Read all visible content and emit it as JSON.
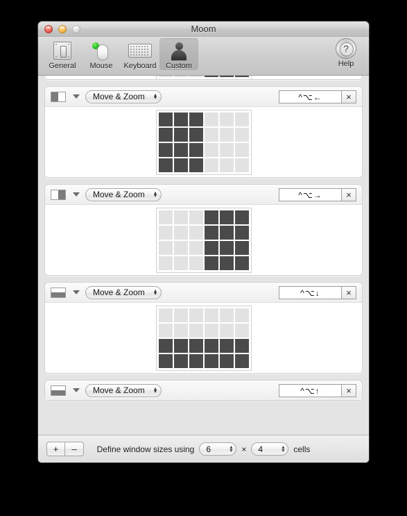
{
  "window": {
    "title": "Moom",
    "traffic_lights": [
      "close",
      "minimize",
      "zoom"
    ]
  },
  "toolbar": {
    "items": [
      {
        "label": "General",
        "icon": "light-switch-icon",
        "selected": false
      },
      {
        "label": "Mouse",
        "icon": "mouse-icon",
        "selected": false
      },
      {
        "label": "Keyboard",
        "icon": "keyboard-icon",
        "selected": false
      },
      {
        "label": "Custom",
        "icon": "person-icon",
        "selected": true
      }
    ],
    "help": {
      "label": "Help",
      "icon": "help-question-icon"
    }
  },
  "grid_size": {
    "cols": 6,
    "rows": 4
  },
  "panels": [
    {
      "clipped": true,
      "thumb": {
        "type": "half-right",
        "orientation": "row"
      },
      "action": "Move & Zoom",
      "hotkey": "",
      "clear_label": "×",
      "grid": {
        "cols": 6,
        "rows": 4,
        "filled": [
          [
            false,
            false,
            false,
            true,
            true,
            true
          ],
          [
            false,
            false,
            false,
            true,
            true,
            true
          ],
          [
            false,
            false,
            false,
            true,
            true,
            true
          ],
          [
            false,
            false,
            false,
            true,
            true,
            true
          ]
        ]
      }
    },
    {
      "clipped": false,
      "thumb": {
        "type": "half-left",
        "orientation": "row"
      },
      "action": "Move & Zoom",
      "hotkey": "^⌥←",
      "clear_label": "×",
      "grid": {
        "cols": 6,
        "rows": 4,
        "filled": [
          [
            true,
            true,
            true,
            false,
            false,
            false
          ],
          [
            true,
            true,
            true,
            false,
            false,
            false
          ],
          [
            true,
            true,
            true,
            false,
            false,
            false
          ],
          [
            true,
            true,
            true,
            false,
            false,
            false
          ]
        ]
      }
    },
    {
      "clipped": false,
      "thumb": {
        "type": "half-right",
        "orientation": "row"
      },
      "action": "Move & Zoom",
      "hotkey": "^⌥→",
      "clear_label": "×",
      "grid": {
        "cols": 6,
        "rows": 4,
        "filled": [
          [
            false,
            false,
            false,
            true,
            true,
            true
          ],
          [
            false,
            false,
            false,
            true,
            true,
            true
          ],
          [
            false,
            false,
            false,
            true,
            true,
            true
          ],
          [
            false,
            false,
            false,
            true,
            true,
            true
          ]
        ]
      }
    },
    {
      "clipped": false,
      "thumb": {
        "type": "half-bottom",
        "orientation": "col"
      },
      "action": "Move & Zoom",
      "hotkey": "^⌥↓",
      "clear_label": "×",
      "grid": {
        "cols": 6,
        "rows": 4,
        "filled": [
          [
            false,
            false,
            false,
            false,
            false,
            false
          ],
          [
            false,
            false,
            false,
            false,
            false,
            false
          ],
          [
            true,
            true,
            true,
            true,
            true,
            true
          ],
          [
            true,
            true,
            true,
            true,
            true,
            true
          ]
        ]
      }
    },
    {
      "clipped": true,
      "cut_bottom": true,
      "thumb": {
        "type": "half-bottom",
        "orientation": "col"
      },
      "action": "Move & Zoom",
      "hotkey": "^⌥↑",
      "clear_label": "×",
      "grid": {
        "cols": 6,
        "rows": 4,
        "filled": []
      }
    }
  ],
  "bottom_bar": {
    "add_label": "+",
    "remove_label": "–",
    "define_prefix": "Define window sizes using",
    "cols_value": "6",
    "times_symbol": "×",
    "rows_value": "4",
    "suffix": "cells"
  },
  "colors": {
    "cell_on": "#4a4a4a",
    "cell_off": "#e2e2e2",
    "panel_bg": "#ffffff",
    "content_bg": "#e4e4e4",
    "backdrop": "#000000"
  }
}
